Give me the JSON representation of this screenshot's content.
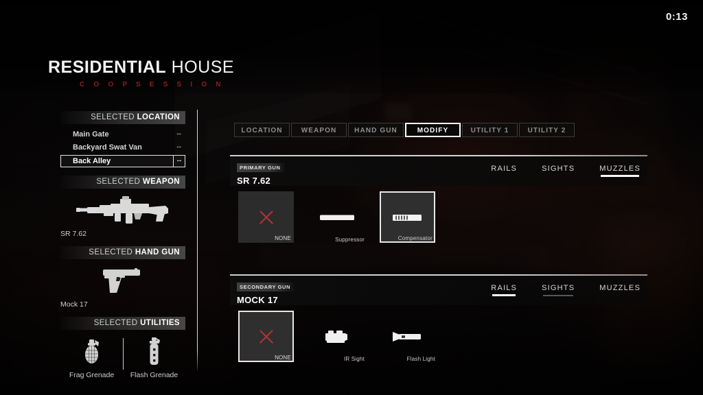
{
  "hud": {
    "timer": "0:13",
    "title_word1": "RESIDENTIAL",
    "title_word2": "HOUSE",
    "subtitle": "C O O P  S E S S I O N",
    "accent_red": "#8d1f1f",
    "x_red": "#b43333"
  },
  "sidebar": {
    "location": {
      "header_light": "SELECTED",
      "header_bold": "LOCATION",
      "items": [
        {
          "label": "Main Gate",
          "value": "--",
          "selected": false
        },
        {
          "label": "Backyard Swat Van",
          "value": "--",
          "selected": false
        },
        {
          "label": "Back Alley",
          "value": "--",
          "selected": true
        }
      ]
    },
    "weapon": {
      "header_light": "SELECTED",
      "header_bold": "WEAPON",
      "name": "SR 7.62",
      "icon": "assault-rifle-icon"
    },
    "handgun": {
      "header_light": "SELECTED",
      "header_bold": "HAND GUN",
      "name": "Mock 17",
      "icon": "pistol-icon"
    },
    "utilities": {
      "header_light": "SELECTED",
      "header_bold": "UTILITIES",
      "items": [
        {
          "label": "Frag Grenade",
          "icon": "frag-grenade-icon"
        },
        {
          "label": "Flash Grenade",
          "icon": "flash-grenade-icon"
        }
      ]
    }
  },
  "tabs": [
    {
      "label": "LOCATION",
      "active": false
    },
    {
      "label": "WEAPON",
      "active": false
    },
    {
      "label": "HAND GUN",
      "active": false
    },
    {
      "label": "MODIFY",
      "active": true
    },
    {
      "label": "UTILITY 1",
      "active": false
    },
    {
      "label": "UTILITY 2",
      "active": false
    }
  ],
  "primary_gun": {
    "badge": "PRIMARY GUN",
    "name": "SR 7.62",
    "subtabs": [
      {
        "label": "RAILS",
        "state": "idle"
      },
      {
        "label": "SIGHTS",
        "state": "idle"
      },
      {
        "label": "MUZZLES",
        "state": "active"
      }
    ],
    "options": [
      {
        "label": "NONE",
        "icon": "none-x-icon",
        "selected": false,
        "card": true
      },
      {
        "label": "Suppressor",
        "icon": "suppressor-icon",
        "selected": false,
        "card": false
      },
      {
        "label": "Compensator",
        "icon": "compensator-icon",
        "selected": true,
        "card": true
      }
    ]
  },
  "secondary_gun": {
    "badge": "SECONDARY GUN",
    "name": "MOCK 17",
    "subtabs": [
      {
        "label": "RAILS",
        "state": "active"
      },
      {
        "label": "SIGHTS",
        "state": "hover"
      },
      {
        "label": "MUZZLES",
        "state": "idle"
      }
    ],
    "options": [
      {
        "label": "NONE",
        "icon": "none-x-icon",
        "selected": true,
        "card": true
      },
      {
        "label": "IR Sight",
        "icon": "ir-sight-icon",
        "selected": false,
        "card": false
      },
      {
        "label": "Flash Light",
        "icon": "flash-light-icon",
        "selected": false,
        "card": false
      }
    ]
  }
}
